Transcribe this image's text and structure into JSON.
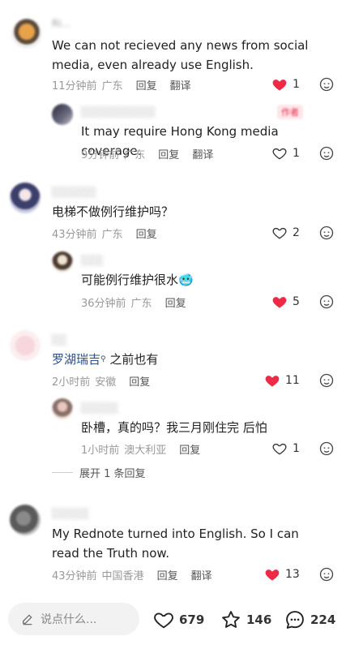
{
  "comments": [
    {
      "username": "Ri...",
      "text": "We can not recieved any news from social media, even already use English.",
      "time": "11分钟前",
      "location": "广东",
      "reply_label": "回复",
      "translate_label": "翻译",
      "likes": "1",
      "liked": true
    },
    {
      "username": "░░░░░░░░░░",
      "badge": "作者",
      "text": "It may require Hong Kong media coverage.",
      "time": "9分钟前",
      "location": "广东",
      "reply_label": "回复",
      "translate_label": "翻译",
      "likes": "1",
      "liked": false
    },
    {
      "username": "░░░░░░",
      "text": "电梯不做例行维护吗？",
      "time": "43分钟前",
      "location": "广东",
      "reply_label": "回复",
      "likes": "2",
      "liked": false
    },
    {
      "username": "░░░",
      "text": "可能例行维护很水🥶",
      "time": "36分钟前",
      "location": "广东",
      "reply_label": "回复",
      "likes": "5",
      "liked": true
    },
    {
      "username": "░░",
      "mention": "罗湖瑞吉",
      "text": " 之前也有",
      "time": "2小时前",
      "location": "安徽",
      "reply_label": "回复",
      "likes": "11",
      "liked": true
    },
    {
      "username": "░░░░░",
      "text": "卧槽，真的吗？我三月刚住完 后怕",
      "time": "1小时前",
      "location": "澳大利亚",
      "reply_label": "回复",
      "likes": "1",
      "liked": false
    },
    {
      "username": "░░░░░",
      "text": "My Rednote turned into English. So I can read the Truth now.",
      "time": "43分钟前",
      "location": "中国香港",
      "reply_label": "回复",
      "translate_label": "翻译",
      "likes": "13",
      "liked": true
    }
  ],
  "expand_replies": "展开 1 条回复",
  "bottom_bar": {
    "input_placeholder": "说点什么...",
    "likes": "679",
    "stars": "146",
    "comments": "224"
  },
  "colors": {
    "liked_heart": "#ee2b47",
    "mention": "#2f4f86"
  }
}
